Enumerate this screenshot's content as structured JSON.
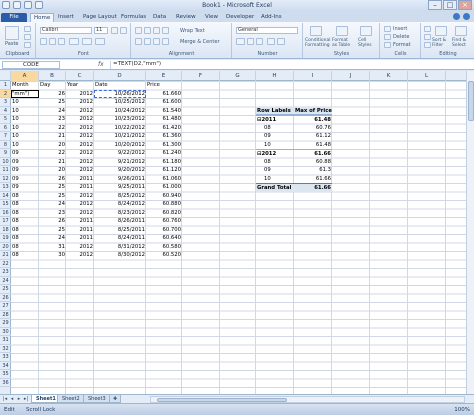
{
  "window": {
    "title": "Book1 - Microsoft Excel"
  },
  "tabs": [
    "File",
    "Home",
    "Insert",
    "Page Layout",
    "Formulas",
    "Data",
    "Review",
    "View",
    "Developer",
    "Add-Ins"
  ],
  "ribbon": {
    "clipboard": {
      "label": "Clipboard",
      "paste": "Paste"
    },
    "font": {
      "label": "Font",
      "name": "Calibri",
      "size": "11"
    },
    "alignment": {
      "label": "Alignment",
      "wrap": "Wrap Text",
      "merge": "Merge & Center"
    },
    "number": {
      "label": "Number",
      "format": "General"
    },
    "styles": {
      "label": "Styles",
      "cond": "Conditional Formatting",
      "table": "Format as Table",
      "cell": "Cell Styles"
    },
    "cells": {
      "label": "Cells",
      "insert": "Insert",
      "delete": "Delete",
      "format": "Format"
    },
    "editing": {
      "label": "Editing",
      "sort": "Sort & Filter",
      "find": "Find & Select"
    }
  },
  "formula_bar": {
    "name_box": "CODE",
    "fx": "fx",
    "formula": "=TEXT(D2,\"mm\")"
  },
  "columns": [
    "A",
    "B",
    "C",
    "D",
    "E",
    "F",
    "G",
    "H",
    "I",
    "J",
    "K",
    "L"
  ],
  "rows": [
    "1",
    "2",
    "3",
    "4",
    "5",
    "6",
    "7",
    "8",
    "9",
    "10",
    "11",
    "12",
    "13",
    "14",
    "15",
    "16",
    "17",
    "18",
    "19",
    "20",
    "21",
    "22",
    "23",
    "24",
    "25",
    "26",
    "27",
    "28",
    "29",
    "30",
    "31",
    "32",
    "33",
    "34",
    "35",
    "36"
  ],
  "table": {
    "headers": [
      "Month",
      "Day",
      "Year",
      "Date",
      "Price"
    ],
    "rows": [
      [
        "\"mm\")",
        "26",
        "2012",
        "10/26/2012",
        "61.660"
      ],
      [
        "10",
        "25",
        "2012",
        "10/25/2012",
        "61.600"
      ],
      [
        "10",
        "24",
        "2012",
        "10/24/2012",
        "61.540"
      ],
      [
        "10",
        "23",
        "2012",
        "10/23/2012",
        "61.480"
      ],
      [
        "10",
        "22",
        "2012",
        "10/22/2012",
        "61.420"
      ],
      [
        "10",
        "21",
        "2012",
        "10/21/2012",
        "61.360"
      ],
      [
        "10",
        "20",
        "2012",
        "10/20/2012",
        "61.300"
      ],
      [
        "09",
        "22",
        "2012",
        "9/22/2012",
        "61.240"
      ],
      [
        "09",
        "21",
        "2012",
        "9/21/2012",
        "61.180"
      ],
      [
        "09",
        "20",
        "2012",
        "9/20/2012",
        "61.120"
      ],
      [
        "09",
        "26",
        "2011",
        "9/26/2011",
        "61.060"
      ],
      [
        "09",
        "25",
        "2011",
        "9/25/2011",
        "61.000"
      ],
      [
        "08",
        "25",
        "2012",
        "8/25/2012",
        "60.940"
      ],
      [
        "08",
        "24",
        "2012",
        "8/24/2012",
        "60.880"
      ],
      [
        "08",
        "23",
        "2012",
        "8/23/2012",
        "60.820"
      ],
      [
        "08",
        "26",
        "2011",
        "8/26/2011",
        "60.760"
      ],
      [
        "08",
        "25",
        "2011",
        "8/25/2011",
        "60.700"
      ],
      [
        "08",
        "24",
        "2011",
        "8/24/2011",
        "60.640"
      ],
      [
        "08",
        "31",
        "2012",
        "8/31/2012",
        "60.580"
      ],
      [
        "08",
        "30",
        "2012",
        "8/30/2012",
        "60.520"
      ]
    ]
  },
  "pivot": {
    "header": [
      "Row Labels",
      "Max of Price"
    ],
    "rows": [
      {
        "label": "⊟2011",
        "value": "61.48",
        "bold": true
      },
      {
        "label": "08",
        "value": "60.76",
        "bold": false
      },
      {
        "label": "09",
        "value": "61.12",
        "bold": false
      },
      {
        "label": "10",
        "value": "61.48",
        "bold": false
      },
      {
        "label": "⊟2012",
        "value": "61.66",
        "bold": true
      },
      {
        "label": "08",
        "value": "60.88",
        "bold": false
      },
      {
        "label": "09",
        "value": "61.3",
        "bold": false
      },
      {
        "label": "10",
        "value": "61.66",
        "bold": false
      }
    ],
    "total": [
      "Grand Total",
      "61.66"
    ]
  },
  "sheet_tabs": [
    "Sheet1",
    "Sheet2",
    "Sheet3"
  ],
  "status": {
    "mode": "Edit",
    "scroll_lock": "Scroll Lock",
    "zoom": "100%"
  }
}
